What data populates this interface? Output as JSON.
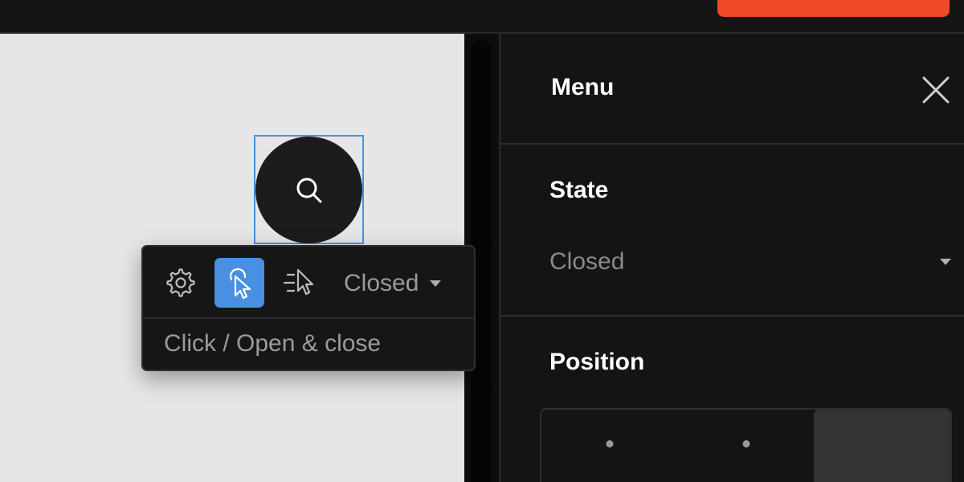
{
  "colors": {
    "accent": "#4a90e2",
    "brand": "#ee4a26",
    "panel_bg": "#141414",
    "canvas_bg": "#e6e6e6"
  },
  "canvas": {
    "fab": {
      "icon": "search-icon"
    }
  },
  "popover": {
    "tools": [
      {
        "icon": "gear-icon",
        "active": false
      },
      {
        "icon": "click-cursor-icon",
        "active": true
      },
      {
        "icon": "hover-cursor-icon",
        "active": false
      }
    ],
    "state_value": "Closed",
    "hint": "Click / Open & close"
  },
  "panel": {
    "title": "Menu",
    "close_icon": "close-icon",
    "state": {
      "label": "State",
      "value": "Closed"
    },
    "position": {
      "label": "Position",
      "selected_index": 2
    }
  }
}
